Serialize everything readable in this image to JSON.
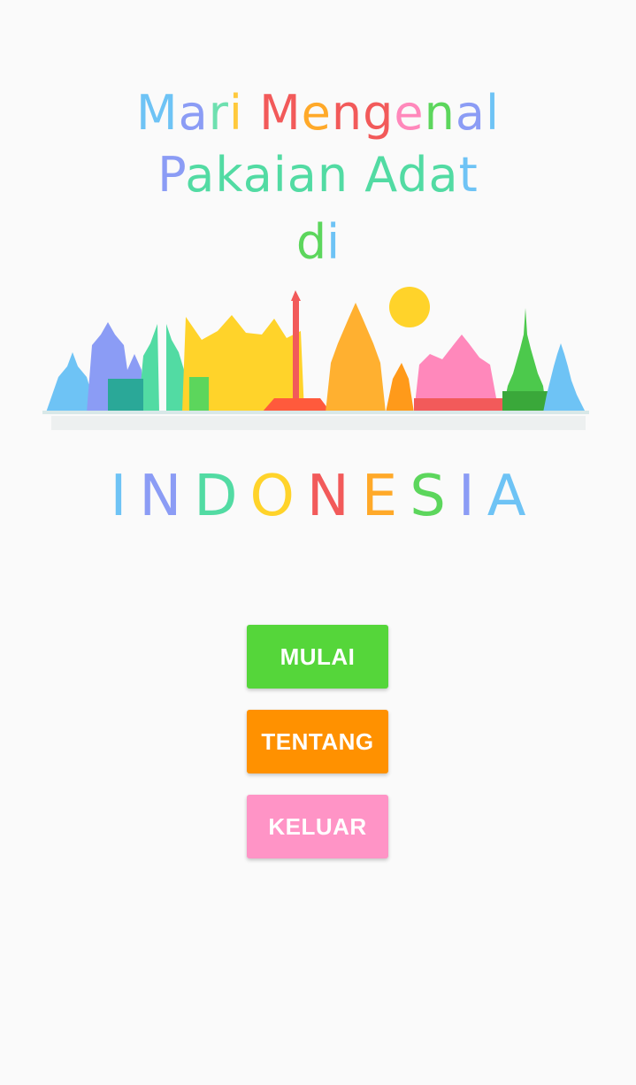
{
  "title": {
    "line1": [
      {
        "ch": "M",
        "color": "#6ec3f5"
      },
      {
        "ch": "a",
        "color": "#8b9cf5"
      },
      {
        "ch": "r",
        "color": "#6ee0b0"
      },
      {
        "ch": "i",
        "color": "#ffc93c"
      },
      {
        "ch": " ",
        "color": "#000000"
      },
      {
        "ch": "M",
        "color": "#f25a5a"
      },
      {
        "ch": "e",
        "color": "#ffa929"
      },
      {
        "ch": "n",
        "color": "#f25a5a"
      },
      {
        "ch": "g",
        "color": "#f25a5a"
      },
      {
        "ch": "e",
        "color": "#ff88bb"
      },
      {
        "ch": "n",
        "color": "#5cd65c"
      },
      {
        "ch": "a",
        "color": "#8b9cf5"
      },
      {
        "ch": "l",
        "color": "#6ec3f5"
      }
    ],
    "line2": [
      {
        "ch": "P",
        "color": "#8b9cf5"
      },
      {
        "ch": "akaian Ada",
        "color": "#52dba3"
      },
      {
        "ch": "t",
        "color": "#6ec3f5"
      }
    ],
    "line3": [
      {
        "ch": "d",
        "color": "#5cd65c"
      },
      {
        "ch": "i",
        "color": "#6ec3f5"
      }
    ]
  },
  "brand": {
    "letters": [
      {
        "ch": "I",
        "color": "#6ec3f5"
      },
      {
        "ch": "N",
        "color": "#8b9cf5"
      },
      {
        "ch": "D",
        "color": "#52dba3"
      },
      {
        "ch": "O",
        "color": "#ffd32a"
      },
      {
        "ch": "N",
        "color": "#f25a5a"
      },
      {
        "ch": "E",
        "color": "#ffa929"
      },
      {
        "ch": "S",
        "color": "#5cd65c"
      },
      {
        "ch": "I",
        "color": "#8b9cf5"
      },
      {
        "ch": "A",
        "color": "#6ec3f5"
      }
    ]
  },
  "skyline": {
    "icon": "indonesia-landmarks-skyline-illustration",
    "sun_color": "#ffd32a"
  },
  "buttons": {
    "start": {
      "label": "MULAI",
      "color": "#55d63a"
    },
    "about": {
      "label": "TENTANG",
      "color": "#ff9100"
    },
    "exit": {
      "label": "KELUAR",
      "color": "#ff94c6"
    }
  }
}
